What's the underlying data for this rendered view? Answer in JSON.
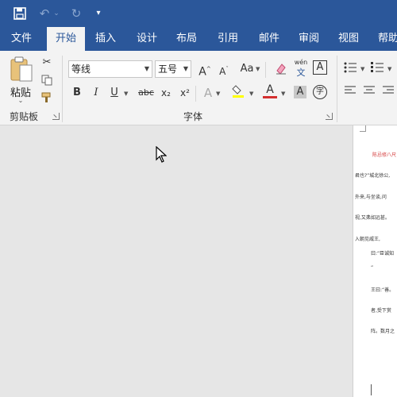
{
  "tabs": [
    "文件",
    "开始",
    "插入",
    "设计",
    "布局",
    "引用",
    "邮件",
    "审阅",
    "视图",
    "帮助"
  ],
  "clipboard": {
    "paste_label": "粘贴",
    "group_label": "剪贴板"
  },
  "font": {
    "font_name": "等线",
    "font_size": "五号",
    "aa_label": "Aa",
    "wen_label": "wén",
    "wen_char": "文",
    "a_box": "A",
    "bold": "B",
    "italic": "I",
    "underline": "U",
    "strike": "abc",
    "sub": "x₂",
    "sup": "x²",
    "a_effect": "A",
    "a_color": "A",
    "a_shade": "A",
    "enclose": "字",
    "group_label": "字体"
  },
  "colors": {
    "brand": "#2b579a",
    "red_text": "#d43b3b",
    "highlight": "#ffff00"
  },
  "document": {
    "lines": [
      "陈忌修八尺",
      "君也?”城北徐公,",
      "外来,与坐谈,问",
      "视,又弗如远甚。",
      "入朝见威王,",
      "曰:“臣诚知",
      "”",
      "王曰:“善。",
      "者,受下赏",
      "阵。数月之"
    ]
  }
}
